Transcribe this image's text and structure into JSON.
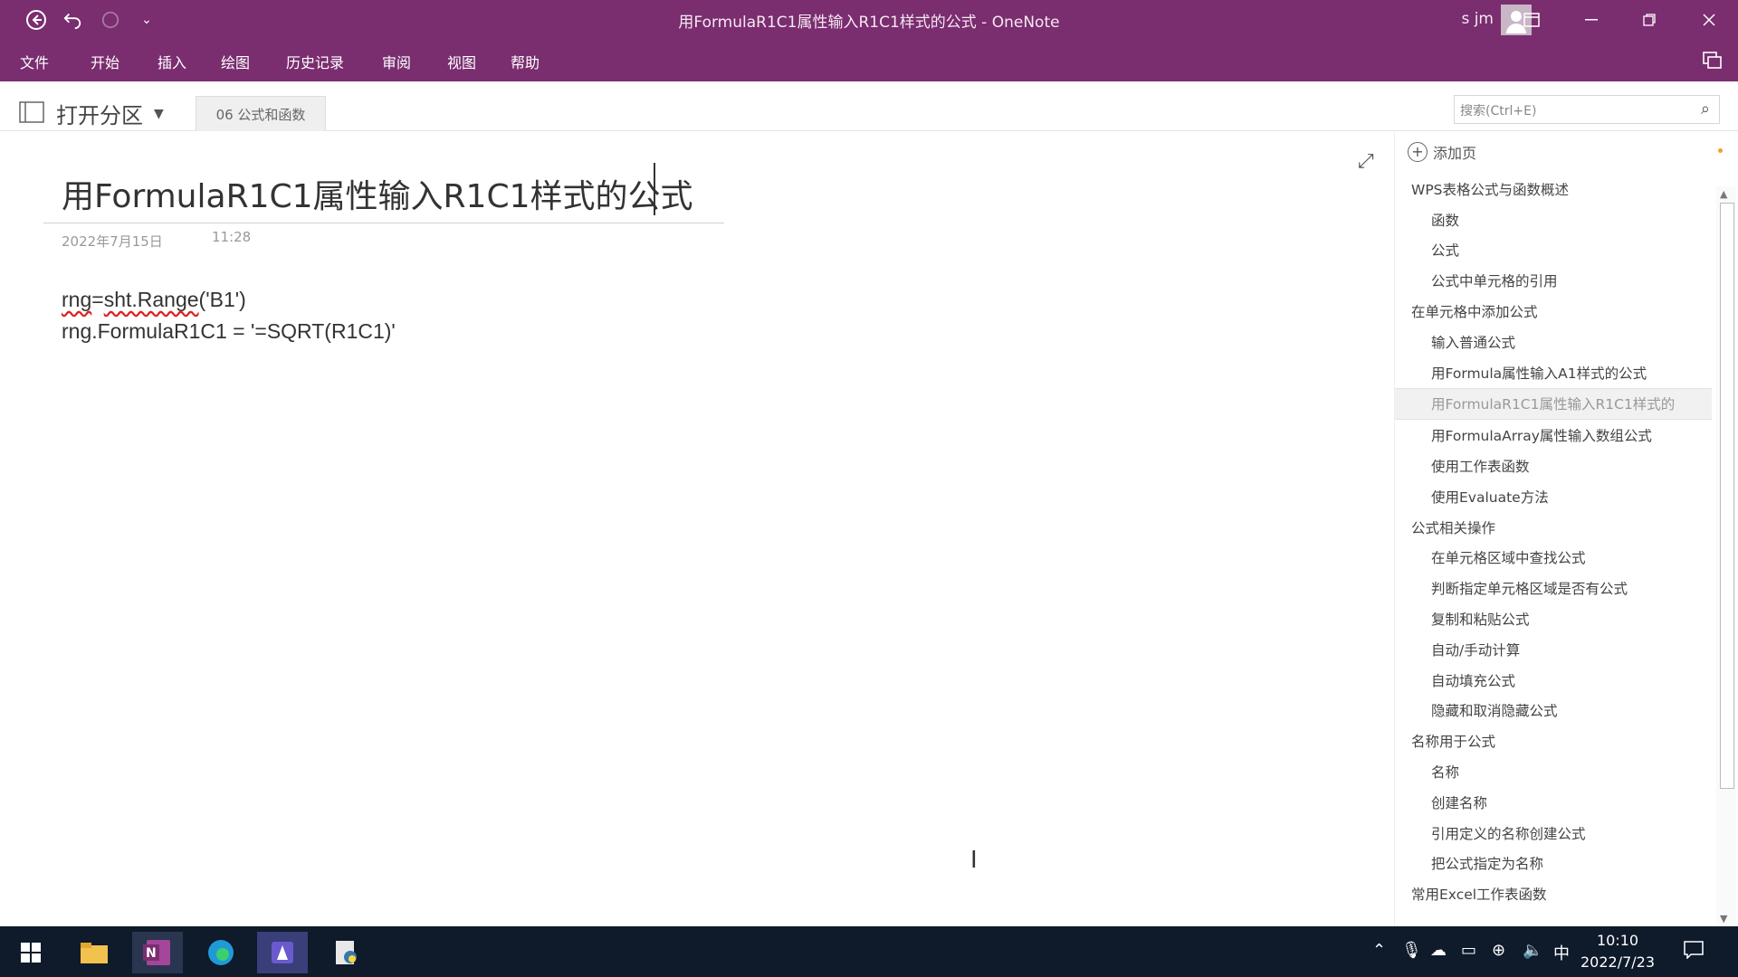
{
  "titlebar": {
    "title": "用FormulaR1C1属性输入R1C1样式的公式  -  OneNote",
    "user": "s jm"
  },
  "menu": [
    "文件",
    "开始",
    "插入",
    "绘图",
    "历史记录",
    "审阅",
    "视图",
    "帮助"
  ],
  "sectionbar": {
    "open_section_label": "打开分区",
    "section_tab": "06 公式和函数",
    "search_placeholder": "搜索(Ctrl+E)"
  },
  "page": {
    "title": "用FormulaR1C1属性输入R1C1样式的公式",
    "date": "2022年7月15日",
    "time": "11:28",
    "code_line1_a": "rng",
    "code_line1_b": "=",
    "code_line1_c": "sht.Range",
    "code_line1_d": "('B1')",
    "code_line2": "rng.FormulaR1C1 = '=SQRT(R1C1)'"
  },
  "pagepane": {
    "add_page_label": "添加页",
    "pages": [
      {
        "label": "WPS表格公式与函数概述",
        "level": 0
      },
      {
        "label": "函数",
        "level": 1
      },
      {
        "label": "公式",
        "level": 1
      },
      {
        "label": "公式中单元格的引用",
        "level": 1
      },
      {
        "label": "在单元格中添加公式",
        "level": 0
      },
      {
        "label": "输入普通公式",
        "level": 1
      },
      {
        "label": "用Formula属性输入A1样式的公式",
        "level": 1
      },
      {
        "label": "用FormulaR1C1属性输入R1C1样式的",
        "level": 1,
        "selected": true
      },
      {
        "label": "用FormulaArray属性输入数组公式",
        "level": 1
      },
      {
        "label": "使用工作表函数",
        "level": 1
      },
      {
        "label": "使用Evaluate方法",
        "level": 1
      },
      {
        "label": "公式相关操作",
        "level": 0
      },
      {
        "label": "在单元格区域中查找公式",
        "level": 1
      },
      {
        "label": "判断指定单元格区域是否有公式",
        "level": 1
      },
      {
        "label": "复制和粘贴公式",
        "level": 1
      },
      {
        "label": "自动/手动计算",
        "level": 1
      },
      {
        "label": "自动填充公式",
        "level": 1
      },
      {
        "label": "隐藏和取消隐藏公式",
        "level": 1
      },
      {
        "label": "名称用于公式",
        "level": 0
      },
      {
        "label": "名称",
        "level": 1
      },
      {
        "label": "创建名称",
        "level": 1
      },
      {
        "label": "引用定义的名称创建公式",
        "level": 1
      },
      {
        "label": "把公式指定为名称",
        "level": 1
      },
      {
        "label": "常用Excel工作表函数",
        "level": 0
      }
    ]
  },
  "taskbar": {
    "time": "10:10",
    "date": "2022/7/23",
    "ime": "中"
  },
  "colors": {
    "accent": "#7a2d6f",
    "taskbar": "#0f1a2b"
  }
}
